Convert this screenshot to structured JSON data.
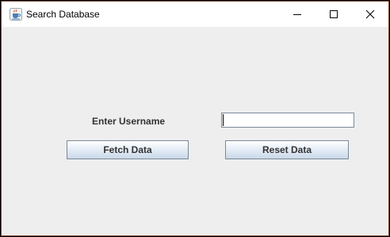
{
  "window": {
    "title": "Search Database",
    "app_icon": "java-coffee-cup-icon",
    "controls": {
      "minimize_icon": "minimize-icon",
      "maximize_icon": "maximize-icon",
      "close_icon": "close-icon"
    }
  },
  "form": {
    "username_label": "Enter Username",
    "username_value": "",
    "fetch_label": "Fetch Data",
    "reset_label": "Reset Data"
  },
  "colors": {
    "content_bg": "#eeeeee",
    "titlebar_bg": "#ffffff",
    "button_border": "#7a8a99",
    "label_text": "#333333"
  }
}
